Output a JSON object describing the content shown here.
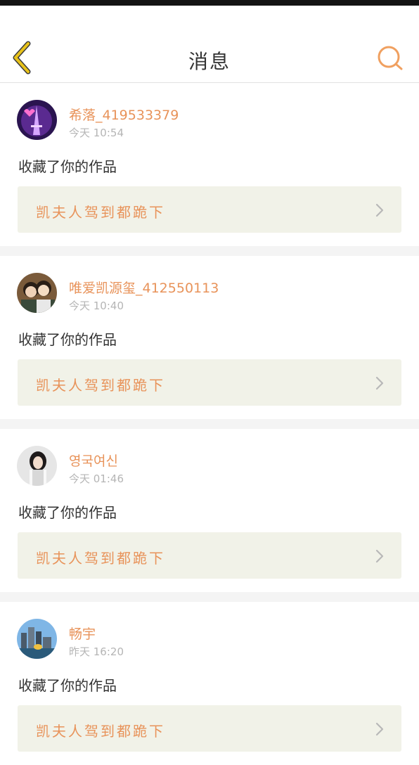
{
  "header": {
    "title": "消息",
    "back_icon": "chevron-left-icon",
    "search_icon": "search-icon",
    "accent": "#e8935a",
    "back_color": "#e8c21a"
  },
  "messages": [
    {
      "username": "希落_419533379",
      "time": "今天 10:54",
      "action": "收藏了你的作品",
      "work_title": "凯夫人驾到都跪下"
    },
    {
      "username": "唯爱凯源玺_412550113",
      "time": "今天 10:40",
      "action": "收藏了你的作品",
      "work_title": "凯夫人驾到都跪下"
    },
    {
      "username": "영국여신",
      "time": "今天 01:46",
      "action": "收藏了你的作品",
      "work_title": "凯夫人驾到都跪下"
    },
    {
      "username": "畅宇",
      "time": "昨天 16:20",
      "action": "收藏了你的作品",
      "work_title": "凯夫人驾到都跪下"
    }
  ]
}
